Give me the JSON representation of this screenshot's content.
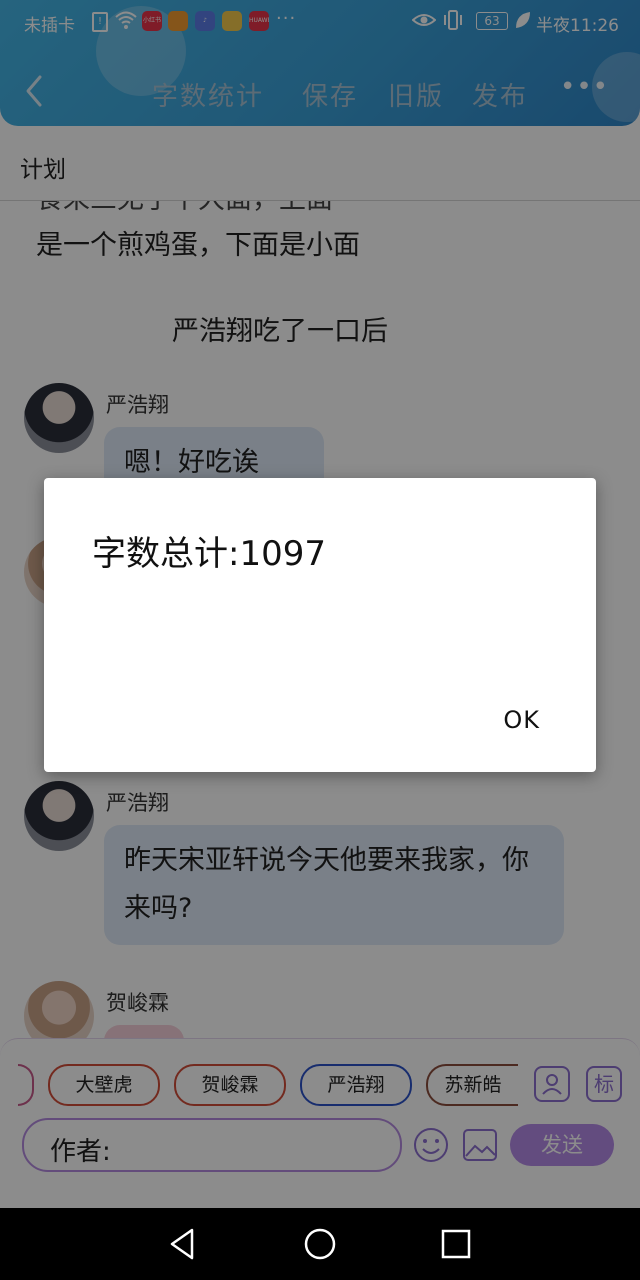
{
  "status_bar": {
    "carrier": "未插卡",
    "sim_icon_text": "!",
    "app_icons": [
      {
        "name": "xiaohongshu-icon",
        "label": "小红书",
        "color": "#e8334a"
      },
      {
        "name": "shopping-icon",
        "label": "",
        "color": "#f29b30"
      },
      {
        "name": "music-icon",
        "label": "",
        "color": "#5b7de8"
      },
      {
        "name": "bird-icon",
        "label": "",
        "color": "#f2c94c"
      },
      {
        "name": "huawei-icon",
        "label": "HUAWEI",
        "color": "#e8334a"
      }
    ],
    "more_dots": "···",
    "battery": "63",
    "time": "半夜11:26"
  },
  "toolbar": {
    "word_count": "字数统计",
    "save": "保存",
    "old_version": "旧版",
    "publish": "发布",
    "more": "•••"
  },
  "page": {
    "section": "计划"
  },
  "chat": {
    "cut_line": "食来三无了个大面，上面",
    "line2": "是一个煎鸡蛋，下面是小面",
    "narration": "严浩翔吃了一口后",
    "messages": [
      {
        "author": "严浩翔",
        "text": "嗯！好吃诶"
      },
      {
        "author": "严浩翔",
        "text": "昨天宋亚轩说今天他要来我家，你来吗?"
      },
      {
        "author": "贺峻霖",
        "text": ""
      }
    ]
  },
  "dialog": {
    "message": "字数总计:1097",
    "ok": "OK"
  },
  "composer": {
    "chips": [
      "大壁虎",
      "贺峻霖",
      "严浩翔",
      "苏新皓"
    ],
    "author_label": "作者:",
    "send": "发送",
    "tag_icon_text": "标"
  }
}
